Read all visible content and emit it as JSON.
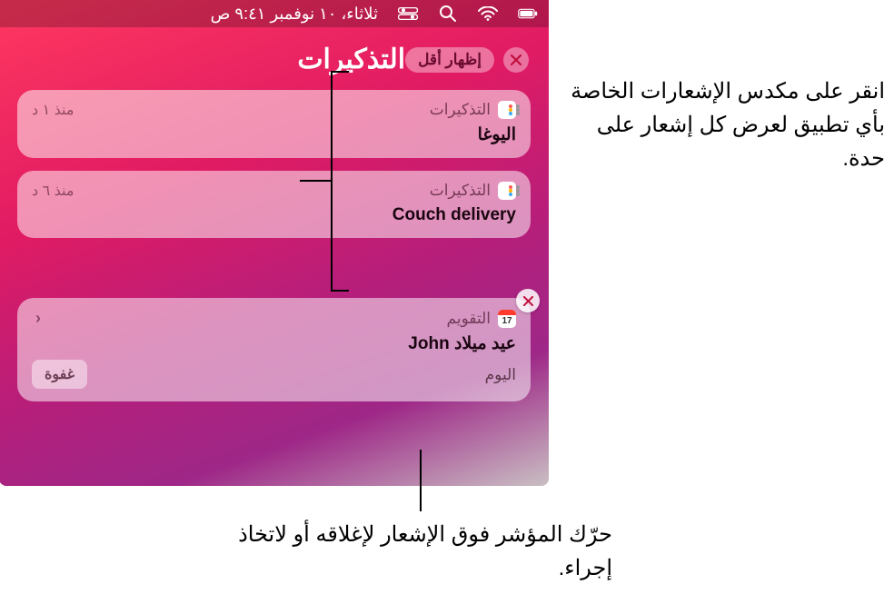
{
  "menubar": {
    "datetime": "ثلاثاء، ١٠ نوفمبر  ٩:٤١ ص"
  },
  "section": {
    "title": "التذكيرات",
    "show_less": "إظهار أقل"
  },
  "reminders": {
    "app_label": "التذكيرات",
    "items": [
      {
        "title": "اليوغا",
        "time": "منذ ١ د"
      },
      {
        "title": "Couch delivery",
        "time": "منذ ٦ د"
      }
    ]
  },
  "calendar": {
    "app_label": "التقويم",
    "icon_day": "17",
    "title": "عيد ميلاد John",
    "subtitle": "اليوم",
    "snooze": "غفوة"
  },
  "callouts": {
    "stack": "انقر على مكدس الإشعارات الخاصة بأي تطبيق لعرض كل إشعار على حدة.",
    "hover": "حرّك المؤشر فوق الإشعار لإغلاقه أو لاتخاذ إجراء."
  }
}
